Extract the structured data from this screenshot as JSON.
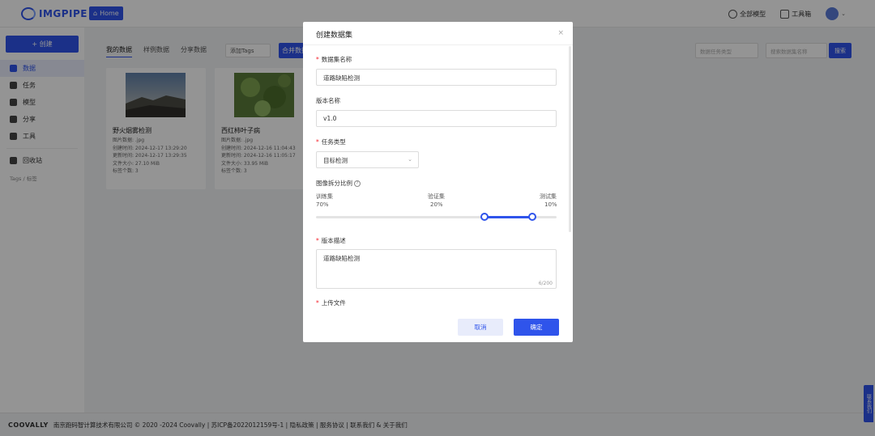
{
  "header": {
    "logo_text": "IMGPIPE",
    "home_label": "Home",
    "all_models_label": "全部模型",
    "toolbox_label": "工具箱"
  },
  "sidebar": {
    "create_label": "+ 创建",
    "items": [
      {
        "label": "数据",
        "active": true
      },
      {
        "label": "任务"
      },
      {
        "label": "模型"
      },
      {
        "label": "分享"
      },
      {
        "label": "工具"
      }
    ],
    "recycle_label": "回收站",
    "tags_line": "Tags / 标签"
  },
  "main": {
    "tabs": [
      "我的数据",
      "样例数据",
      "分享数据"
    ],
    "tags_placeholder": "添加Tags",
    "merge_label": "合并数据",
    "filter_placeholder": "数据任务类型",
    "search_placeholder": "搜索数据集名称",
    "search_label": "搜索",
    "cards": [
      {
        "title": "野火烟雾检测",
        "meta": [
          "图片数据: .jpg",
          "创建时间: 2024-12-17 13:29:20",
          "更新时间: 2024-12-17 13:29:35",
          "文件大小: 27.10 MiB",
          "标签个数: 3"
        ]
      },
      {
        "title": "西红柿叶子病",
        "meta": [
          "图片数据: .jpg",
          "创建时间: 2024-12-16 11:04:43",
          "更新时间: 2024-12-16 11:05:17",
          "文件大小: 33.95 MiB",
          "标签个数: 3"
        ]
      }
    ]
  },
  "footer": {
    "brand": "COOVALLY",
    "text": "南京跑码智计算技术有限公司 © 2020 -2024 Coovally | 苏ICP备2022012159号-1 | 隐私政策 | 服务协议 | 联系我们 & 关于我们"
  },
  "side_float_label": "联系我们",
  "modal": {
    "title": "创建数据集",
    "close": "×",
    "dataset_name_label": "数据集名称",
    "dataset_name_value": "道路缺陷检测",
    "version_name_label": "版本名称",
    "version_name_value": "v1.0",
    "task_type_label": "任务类型",
    "task_type_value": "目标检测",
    "split_label": "图像拆分比例",
    "split": {
      "train_label": "训练集",
      "train_value": "70%",
      "val_label": "验证集",
      "val_value": "20%",
      "test_label": "测试集",
      "test_value": "10%",
      "train_fraction": 0.7,
      "val_fraction": 0.2
    },
    "desc_label": "版本描述",
    "desc_value": "道路缺陷检测",
    "desc_counter": "6/200",
    "upload_label": "上传文件",
    "cancel_label": "取消",
    "ok_label": "确定"
  },
  "colors": {
    "accent": "#2f54eb",
    "required": "#f5222d"
  }
}
